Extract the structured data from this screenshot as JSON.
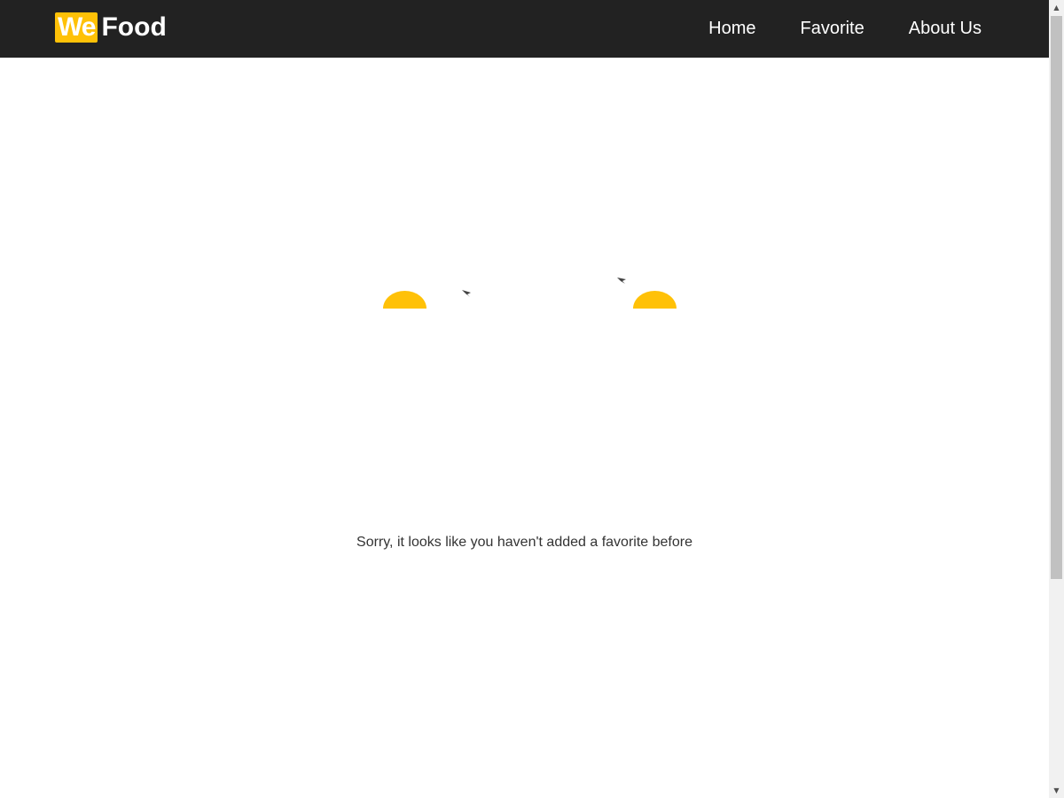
{
  "brand": {
    "logo_part1": "We",
    "logo_part2": "Food",
    "accent_color": "#ffc107"
  },
  "nav": {
    "items": [
      {
        "label": "Home"
      },
      {
        "label": "Favorite"
      },
      {
        "label": "About Us"
      }
    ]
  },
  "main": {
    "empty_message": "Sorry, it looks like you haven't added a favorite before",
    "illustration": {
      "elements": [
        "sun-half-icon",
        "bird-icon",
        "bird-icon",
        "sun-half-icon"
      ]
    }
  },
  "scrollbar": {
    "up_icon": "scroll-up-arrow-icon",
    "down_icon": "scroll-down-arrow-icon"
  }
}
